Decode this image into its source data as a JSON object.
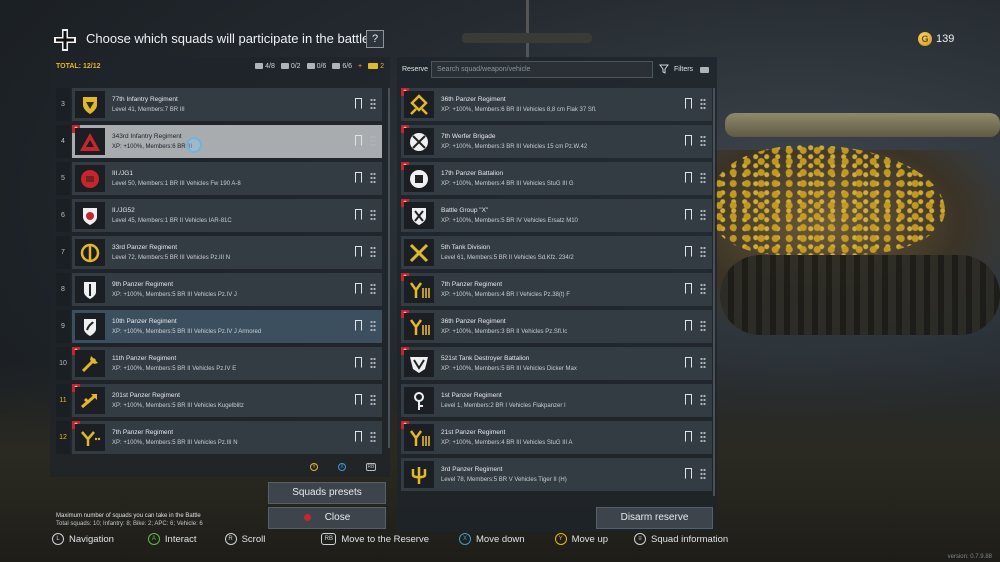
{
  "header": {
    "title": "Choose which squads will participate in the battle",
    "help": "?",
    "currency_value": "139"
  },
  "left": {
    "total_label": "TOTAL: 12/12",
    "counts": [
      {
        "icon": "infantry-icon",
        "value": "4/8"
      },
      {
        "icon": "parachute-icon",
        "value": "0/2"
      },
      {
        "icon": "apc-icon",
        "value": "0/6"
      },
      {
        "icon": "bike-icon",
        "value": "6/6"
      }
    ],
    "plus": "+",
    "plus_value": "2",
    "squads": [
      {
        "num": "3",
        "name": "77th Infantry Regiment",
        "stats": "Level 41, Members:7   BR III",
        "emblem": "yellow-shield",
        "new": false
      },
      {
        "num": "4",
        "name": "343rd Infantry Regiment",
        "stats": "XP: +100%, Members:6   BR III",
        "emblem": "red-triangle",
        "new": true
      },
      {
        "num": "5",
        "name": "III./JG1",
        "stats": "Level 50, Members:1   BR III  Vehicles Fw 190 A-8",
        "emblem": "red-circle-logo",
        "new": false
      },
      {
        "num": "6",
        "name": "II./JG52",
        "stats": "Level 45, Members:1   BR II  Vehicles IAR-81C",
        "emblem": "red-shield-logo",
        "new": false
      },
      {
        "num": "7",
        "name": "33rd Panzer Regiment",
        "stats": "Level 72, Members:5   BR III  Vehicles Pz.III N",
        "emblem": "yellow-circle",
        "new": false
      },
      {
        "num": "8",
        "name": "9th Panzer Regiment",
        "stats": "XP: +100%, Members:5   BR III  Vehicles Pz.IV J",
        "emblem": "sword-emblem",
        "new": false
      },
      {
        "num": "9",
        "name": "10th Panzer Regiment",
        "stats": "XP: +100%, Members:5   BR III  Vehicles Pz.IV J Armored",
        "emblem": "oak-leaf",
        "new": false
      },
      {
        "num": "10",
        "name": "11th Panzer Regiment",
        "stats": "XP: +100%, Members:5   BR II  Vehicles Pz.IV E",
        "emblem": "yellow-axe",
        "new": true
      },
      {
        "num": "11",
        "name": "201st Panzer Regiment",
        "stats": "XP: +100%, Members:5   BR III  Vehicles Kugelblitz",
        "emblem": "yellow-arrows",
        "new": true
      },
      {
        "num": "12",
        "name": "7th Panzer Regiment",
        "stats": "XP: +100%, Members:5   BR III  Vehicles Pz.III N",
        "emblem": "yellow-y",
        "new": true
      }
    ],
    "presets_label": "Squads presets",
    "close_label": "Close",
    "max_info": "Maximum number of squads you can take in the Battle",
    "max_sub": "Total squads: 10; Infantry: 8; Bike: 2; APC: 6; Vehicle: 6"
  },
  "right": {
    "reserve_label": "Reserve",
    "search_placeholder": "Search squad/weapon/vehicle",
    "filters_label": "Filters",
    "squads": [
      {
        "name": "36th Panzer Regiment",
        "stats": "XP: +100%, Members:6   BR III  Vehicles 8,8 cm Flak 37 Sfl.",
        "emblem": "yellow-x",
        "new": true
      },
      {
        "name": "7th Werfer Brigade",
        "stats": "XP: +100%, Members:3   BR III  Vehicles 15 cm Pz.W.42",
        "emblem": "crossed-circle",
        "new": true
      },
      {
        "name": "17th Panzer Battalion",
        "stats": "XP: +100%, Members:4   BR III  Vehicles StuG III G",
        "emblem": "fist-emblem",
        "new": true
      },
      {
        "name": "Battle Group \"X\"",
        "stats": "XP: +100%, Members:5   BR IV  Vehicles Ersatz M10",
        "emblem": "x-shield",
        "new": true
      },
      {
        "name": "5th Tank Division",
        "stats": "Level 61, Members:5   BR II  Vehicles Sd.Kfz. 234/2",
        "emblem": "yellow-cross",
        "new": false
      },
      {
        "name": "7th Panzer Regiment",
        "stats": "XP: +100%, Members:4   BR I  Vehicles Pz.38(t) F",
        "emblem": "yellow-y3",
        "new": true
      },
      {
        "name": "36th Panzer Regiment",
        "stats": "XP: +100%, Members:3   BR II  Vehicles Pz.Sfl.Ic",
        "emblem": "yellow-y3",
        "new": true
      },
      {
        "name": "521st Tank Destroyer Battalion",
        "stats": "XP: +100%, Members:5   BR III  Vehicles Dicker Max",
        "emblem": "bull-emblem",
        "new": true
      },
      {
        "name": "1st Panzer Regiment",
        "stats": "Level 1, Members:2   BR I  Vehicles Flakpanzer I",
        "emblem": "key-emblem",
        "new": false
      },
      {
        "name": "21st Panzer Regiment",
        "stats": "XP: +100%, Members:4   BR III  Vehicles StuG III A",
        "emblem": "yellow-y3",
        "new": true
      },
      {
        "name": "3rd Panzer Regiment",
        "stats": "Level 78, Members:5   BR V  Vehicles Tiger II (H)",
        "emblem": "yellow-trident",
        "new": false
      }
    ],
    "disarm_label": "Disarm reserve"
  },
  "hints": [
    {
      "key": "L",
      "label": "Navigation"
    },
    {
      "key": "A",
      "label": "Interact"
    },
    {
      "key": "R",
      "label": "Scroll"
    },
    {
      "key": "RB",
      "label": "Move to the Reserve"
    },
    {
      "key": "X",
      "label": "Move down"
    },
    {
      "key": "Y",
      "label": "Move up"
    },
    {
      "key": "≡",
      "label": "Squad information"
    }
  ],
  "version": "version: 0.7.9.88",
  "colors": {
    "accent_gold": "#e3b72b",
    "new_badge": "#c6262b",
    "card": "#333b43",
    "selected": "#a8acaf"
  }
}
